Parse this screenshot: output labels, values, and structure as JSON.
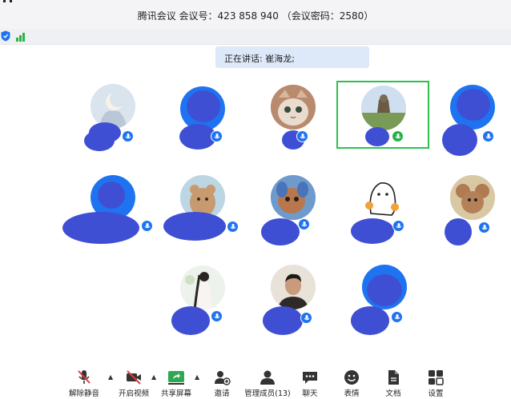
{
  "window": {
    "title": "腾讯会议 会议号：423 858 940 （会议密码：2580）"
  },
  "status": {
    "speaking_text": "正在讲话: 崔海龙;"
  },
  "participants": [
    {
      "name": "",
      "active": false,
      "mic_color": "#1e74f0"
    },
    {
      "name": "",
      "active": false,
      "mic_color": "#1e74f0"
    },
    {
      "name": "",
      "active": false,
      "mic_color": "#1e74f0"
    },
    {
      "name": "",
      "active": true,
      "mic_color": "#24b04a"
    },
    {
      "name": "",
      "active": false,
      "mic_color": "#1e74f0"
    },
    {
      "name": "",
      "active": false,
      "mic_color": "#1e74f0"
    },
    {
      "name": "",
      "active": false,
      "mic_color": "#1e74f0"
    },
    {
      "name": "",
      "active": false,
      "mic_color": "#1e74f0"
    },
    {
      "name": "",
      "active": false,
      "mic_color": "#1e74f0"
    },
    {
      "name": "",
      "active": false,
      "mic_color": "#1e74f0"
    },
    {
      "name": "",
      "active": false,
      "mic_color": "#1e74f0"
    },
    {
      "name": "",
      "active": false,
      "mic_color": "#1e74f0"
    },
    {
      "name": "",
      "active": false,
      "mic_color": "#1e74f0"
    }
  ],
  "toolbar": {
    "unmute": "解除静音",
    "start_video": "开启视频",
    "share_screen": "共享屏幕",
    "invite": "邀请",
    "manage_members": "管理成员(13)",
    "chat": "聊天",
    "reactions": "表情",
    "documents": "文档",
    "settings": "设置"
  },
  "icons": {
    "unmute": "mic-off-icon",
    "start_video": "camera-off-icon",
    "share_screen": "share-screen-icon",
    "invite": "add-user-icon",
    "manage_members": "members-icon",
    "chat": "chat-icon",
    "reactions": "emoji-icon",
    "documents": "document-icon",
    "settings": "settings-icon"
  },
  "colors": {
    "accent": "#1e74f0",
    "speaking_border": "#2ec14f",
    "toolbar_red": "#e23b3b",
    "share_green": "#2fa84f",
    "redaction": "#3f4fd4"
  }
}
